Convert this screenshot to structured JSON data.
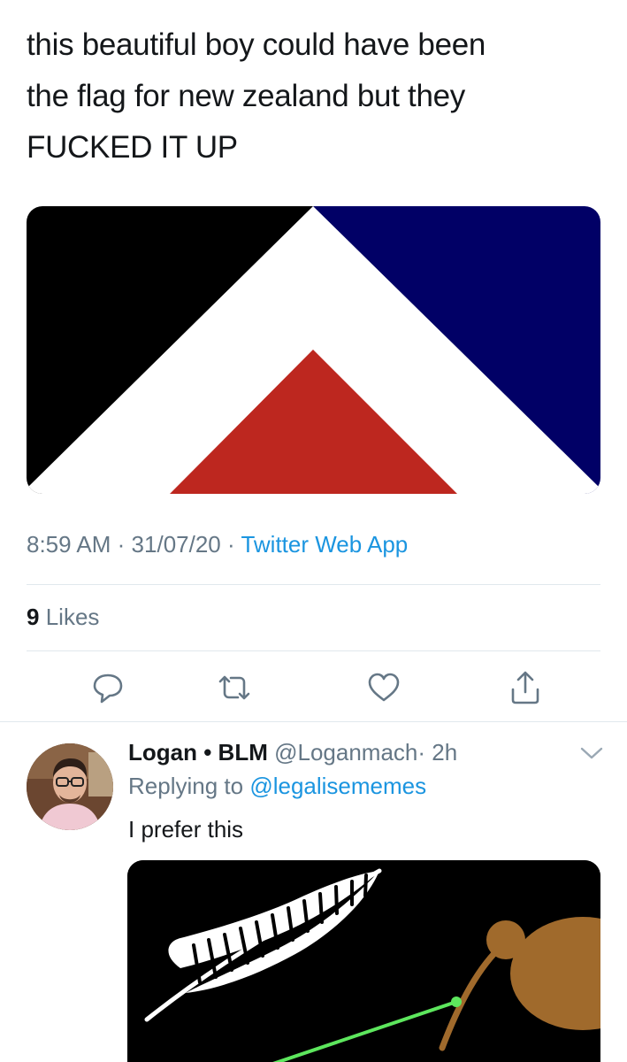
{
  "tweet": {
    "text_lines": [
      "this beautiful boy could have been",
      "the flag for new zealand but they",
      "FUCKED IT UP"
    ],
    "image": {
      "icon": "red-peak-flag-image",
      "colors": {
        "left": "#000000",
        "right": "#010066",
        "chevron": "#ffffff",
        "peak": "#bd271f"
      }
    },
    "time": "8:59 AM",
    "separator": "·",
    "date": "31/07/20",
    "source": "Twitter Web App",
    "likes_count": "9",
    "likes_label": "Likes"
  },
  "actions": [
    {
      "icon": "reply-icon"
    },
    {
      "icon": "retweet-icon"
    },
    {
      "icon": "heart-icon"
    },
    {
      "icon": "share-icon"
    }
  ],
  "reply": {
    "name": "Logan • BLM",
    "handle": "@Loganmach",
    "separator": "·",
    "time": "2h",
    "replying_prefix": "Replying to",
    "replying_to": "@legalisememes",
    "text": "I prefer this",
    "image": {
      "icon": "silver-fern-kiwi-flag-image",
      "colors": {
        "background": "#000000",
        "fern": "#ffffff",
        "kiwi": "#a06a2c",
        "laser": "#5de65d"
      }
    }
  },
  "colors": {
    "text": "#14171a",
    "secondary": "#657786",
    "link": "#1b95e0",
    "divider": "#e1e8ed"
  }
}
